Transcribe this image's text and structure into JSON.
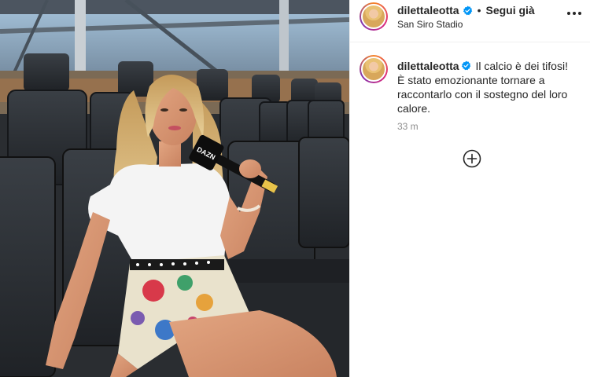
{
  "header": {
    "username": "dilettaleotta",
    "separator": "•",
    "follow_state": "Segui già",
    "location": "San Siro Stadio"
  },
  "caption": {
    "username": "dilettaleotta",
    "text": "Il calcio è dei tifosi! È stato emozionante tornare a raccontarlo con il sostegno del loro calore.",
    "timestamp": "33 m"
  },
  "microphone": {
    "brand_text": "DAZN"
  },
  "icons": {
    "verified": "verified-badge-icon",
    "more": "more-options-icon",
    "load_more": "plus-circle-icon"
  },
  "colors": {
    "verified_blue": "#0095f6",
    "text": "#262626",
    "secondary_text": "#8e8e8e"
  }
}
